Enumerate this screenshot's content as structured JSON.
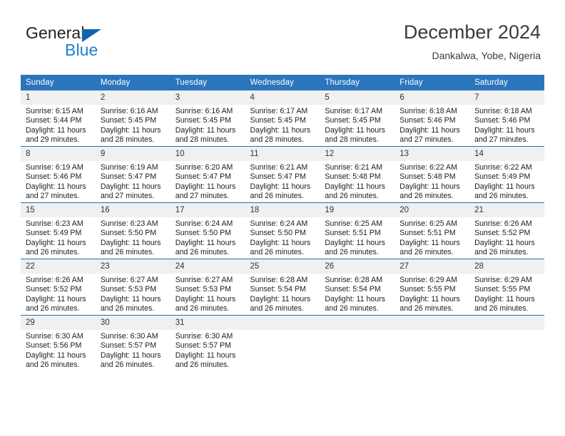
{
  "brand": {
    "word_general": "General",
    "word_blue": "Blue",
    "mark": "triangle-logo",
    "accent_color": "#1b7fd4"
  },
  "header": {
    "title": "December 2024",
    "subtitle": "Dankalwa, Yobe, Nigeria"
  },
  "theme": {
    "header_band": "#2a75bb",
    "row_divider": "#2a6fb0",
    "daynum_band": "#f0f0f0"
  },
  "weekdays": [
    "Sunday",
    "Monday",
    "Tuesday",
    "Wednesday",
    "Thursday",
    "Friday",
    "Saturday"
  ],
  "labels": {
    "sunrise_prefix": "Sunrise:",
    "sunset_prefix": "Sunset:",
    "daylight_prefix": "Daylight:"
  },
  "weeks": [
    [
      {
        "day": "1",
        "sunrise": "Sunrise: 6:15 AM",
        "sunset": "Sunset: 5:44 PM",
        "daylight_line1": "Daylight: 11 hours",
        "daylight_line2": "and 29 minutes."
      },
      {
        "day": "2",
        "sunrise": "Sunrise: 6:16 AM",
        "sunset": "Sunset: 5:45 PM",
        "daylight_line1": "Daylight: 11 hours",
        "daylight_line2": "and 28 minutes."
      },
      {
        "day": "3",
        "sunrise": "Sunrise: 6:16 AM",
        "sunset": "Sunset: 5:45 PM",
        "daylight_line1": "Daylight: 11 hours",
        "daylight_line2": "and 28 minutes."
      },
      {
        "day": "4",
        "sunrise": "Sunrise: 6:17 AM",
        "sunset": "Sunset: 5:45 PM",
        "daylight_line1": "Daylight: 11 hours",
        "daylight_line2": "and 28 minutes."
      },
      {
        "day": "5",
        "sunrise": "Sunrise: 6:17 AM",
        "sunset": "Sunset: 5:45 PM",
        "daylight_line1": "Daylight: 11 hours",
        "daylight_line2": "and 28 minutes."
      },
      {
        "day": "6",
        "sunrise": "Sunrise: 6:18 AM",
        "sunset": "Sunset: 5:46 PM",
        "daylight_line1": "Daylight: 11 hours",
        "daylight_line2": "and 27 minutes."
      },
      {
        "day": "7",
        "sunrise": "Sunrise: 6:18 AM",
        "sunset": "Sunset: 5:46 PM",
        "daylight_line1": "Daylight: 11 hours",
        "daylight_line2": "and 27 minutes."
      }
    ],
    [
      {
        "day": "8",
        "sunrise": "Sunrise: 6:19 AM",
        "sunset": "Sunset: 5:46 PM",
        "daylight_line1": "Daylight: 11 hours",
        "daylight_line2": "and 27 minutes."
      },
      {
        "day": "9",
        "sunrise": "Sunrise: 6:19 AM",
        "sunset": "Sunset: 5:47 PM",
        "daylight_line1": "Daylight: 11 hours",
        "daylight_line2": "and 27 minutes."
      },
      {
        "day": "10",
        "sunrise": "Sunrise: 6:20 AM",
        "sunset": "Sunset: 5:47 PM",
        "daylight_line1": "Daylight: 11 hours",
        "daylight_line2": "and 27 minutes."
      },
      {
        "day": "11",
        "sunrise": "Sunrise: 6:21 AM",
        "sunset": "Sunset: 5:47 PM",
        "daylight_line1": "Daylight: 11 hours",
        "daylight_line2": "and 26 minutes."
      },
      {
        "day": "12",
        "sunrise": "Sunrise: 6:21 AM",
        "sunset": "Sunset: 5:48 PM",
        "daylight_line1": "Daylight: 11 hours",
        "daylight_line2": "and 26 minutes."
      },
      {
        "day": "13",
        "sunrise": "Sunrise: 6:22 AM",
        "sunset": "Sunset: 5:48 PM",
        "daylight_line1": "Daylight: 11 hours",
        "daylight_line2": "and 26 minutes."
      },
      {
        "day": "14",
        "sunrise": "Sunrise: 6:22 AM",
        "sunset": "Sunset: 5:49 PM",
        "daylight_line1": "Daylight: 11 hours",
        "daylight_line2": "and 26 minutes."
      }
    ],
    [
      {
        "day": "15",
        "sunrise": "Sunrise: 6:23 AM",
        "sunset": "Sunset: 5:49 PM",
        "daylight_line1": "Daylight: 11 hours",
        "daylight_line2": "and 26 minutes."
      },
      {
        "day": "16",
        "sunrise": "Sunrise: 6:23 AM",
        "sunset": "Sunset: 5:50 PM",
        "daylight_line1": "Daylight: 11 hours",
        "daylight_line2": "and 26 minutes."
      },
      {
        "day": "17",
        "sunrise": "Sunrise: 6:24 AM",
        "sunset": "Sunset: 5:50 PM",
        "daylight_line1": "Daylight: 11 hours",
        "daylight_line2": "and 26 minutes."
      },
      {
        "day": "18",
        "sunrise": "Sunrise: 6:24 AM",
        "sunset": "Sunset: 5:50 PM",
        "daylight_line1": "Daylight: 11 hours",
        "daylight_line2": "and 26 minutes."
      },
      {
        "day": "19",
        "sunrise": "Sunrise: 6:25 AM",
        "sunset": "Sunset: 5:51 PM",
        "daylight_line1": "Daylight: 11 hours",
        "daylight_line2": "and 26 minutes."
      },
      {
        "day": "20",
        "sunrise": "Sunrise: 6:25 AM",
        "sunset": "Sunset: 5:51 PM",
        "daylight_line1": "Daylight: 11 hours",
        "daylight_line2": "and 26 minutes."
      },
      {
        "day": "21",
        "sunrise": "Sunrise: 6:26 AM",
        "sunset": "Sunset: 5:52 PM",
        "daylight_line1": "Daylight: 11 hours",
        "daylight_line2": "and 26 minutes."
      }
    ],
    [
      {
        "day": "22",
        "sunrise": "Sunrise: 6:26 AM",
        "sunset": "Sunset: 5:52 PM",
        "daylight_line1": "Daylight: 11 hours",
        "daylight_line2": "and 26 minutes."
      },
      {
        "day": "23",
        "sunrise": "Sunrise: 6:27 AM",
        "sunset": "Sunset: 5:53 PM",
        "daylight_line1": "Daylight: 11 hours",
        "daylight_line2": "and 26 minutes."
      },
      {
        "day": "24",
        "sunrise": "Sunrise: 6:27 AM",
        "sunset": "Sunset: 5:53 PM",
        "daylight_line1": "Daylight: 11 hours",
        "daylight_line2": "and 26 minutes."
      },
      {
        "day": "25",
        "sunrise": "Sunrise: 6:28 AM",
        "sunset": "Sunset: 5:54 PM",
        "daylight_line1": "Daylight: 11 hours",
        "daylight_line2": "and 26 minutes."
      },
      {
        "day": "26",
        "sunrise": "Sunrise: 6:28 AM",
        "sunset": "Sunset: 5:54 PM",
        "daylight_line1": "Daylight: 11 hours",
        "daylight_line2": "and 26 minutes."
      },
      {
        "day": "27",
        "sunrise": "Sunrise: 6:29 AM",
        "sunset": "Sunset: 5:55 PM",
        "daylight_line1": "Daylight: 11 hours",
        "daylight_line2": "and 26 minutes."
      },
      {
        "day": "28",
        "sunrise": "Sunrise: 6:29 AM",
        "sunset": "Sunset: 5:55 PM",
        "daylight_line1": "Daylight: 11 hours",
        "daylight_line2": "and 26 minutes."
      }
    ],
    [
      {
        "day": "29",
        "sunrise": "Sunrise: 6:30 AM",
        "sunset": "Sunset: 5:56 PM",
        "daylight_line1": "Daylight: 11 hours",
        "daylight_line2": "and 26 minutes."
      },
      {
        "day": "30",
        "sunrise": "Sunrise: 6:30 AM",
        "sunset": "Sunset: 5:57 PM",
        "daylight_line1": "Daylight: 11 hours",
        "daylight_line2": "and 26 minutes."
      },
      {
        "day": "31",
        "sunrise": "Sunrise: 6:30 AM",
        "sunset": "Sunset: 5:57 PM",
        "daylight_line1": "Daylight: 11 hours",
        "daylight_line2": "and 26 minutes."
      },
      {
        "day": "",
        "sunrise": "",
        "sunset": "",
        "daylight_line1": "",
        "daylight_line2": ""
      },
      {
        "day": "",
        "sunrise": "",
        "sunset": "",
        "daylight_line1": "",
        "daylight_line2": ""
      },
      {
        "day": "",
        "sunrise": "",
        "sunset": "",
        "daylight_line1": "",
        "daylight_line2": ""
      },
      {
        "day": "",
        "sunrise": "",
        "sunset": "",
        "daylight_line1": "",
        "daylight_line2": ""
      }
    ]
  ]
}
